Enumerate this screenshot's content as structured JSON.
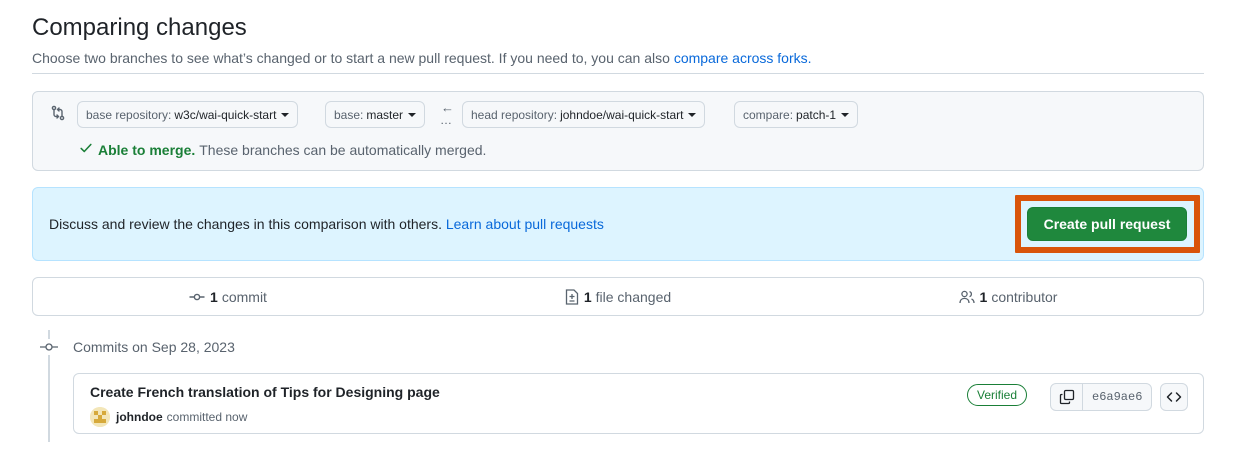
{
  "header": {
    "title": "Comparing changes",
    "description": "Choose two branches to see what’s changed or to start a new pull request. If you need to, you can also",
    "forks_link": "compare across forks."
  },
  "range": {
    "base_repo": {
      "prefix": "base repository:",
      "value": "w3c/wai-quick-start"
    },
    "base_branch": {
      "prefix": "base:",
      "value": "master"
    },
    "head_repo": {
      "prefix": "head repository:",
      "value": "johndoe/wai-quick-start"
    },
    "compare_branch": {
      "prefix": "compare:",
      "value": "patch-1"
    },
    "merge_ok": "Able to merge.",
    "merge_detail": "These branches can be automatically merged."
  },
  "flash": {
    "text": "Discuss and review the changes in this comparison with others.",
    "link": "Learn about pull requests",
    "button": "Create pull request"
  },
  "stats": {
    "commits": {
      "count": "1",
      "label": "commit"
    },
    "files": {
      "count": "1",
      "label": "file changed"
    },
    "contributors": {
      "count": "1",
      "label": "contributor"
    }
  },
  "timeline": {
    "date_heading": "Commits on Sep 28, 2023"
  },
  "commit": {
    "title": "Create French translation of Tips for Designing page",
    "author": "johndoe",
    "action": "committed now",
    "badge": "Verified",
    "sha": "e6a9ae6"
  },
  "colors": {
    "accent_link": "#0969da",
    "success": "#1a7f37",
    "primary_button": "#1f883d",
    "highlight_frame": "#d9540a",
    "flash_bg": "#ddf4ff"
  }
}
